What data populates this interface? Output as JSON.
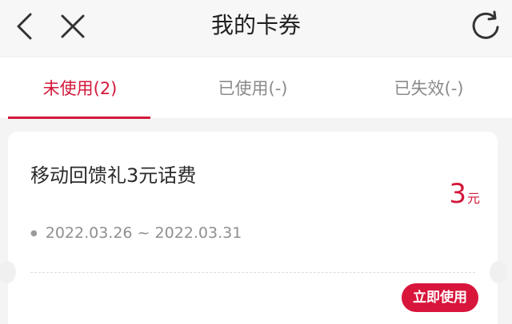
{
  "header": {
    "title": "我的卡券",
    "back_icon": "chevron-left-icon",
    "close_icon": "close-icon",
    "refresh_icon": "refresh-icon"
  },
  "tabs": [
    {
      "label": "未使用(2)",
      "active": true
    },
    {
      "label": "已使用(-)",
      "active": false
    },
    {
      "label": "已失效(-)",
      "active": false
    }
  ],
  "coupon": {
    "name": "移动回馈礼3元话费",
    "value": "3",
    "unit": "元",
    "validity": "2022.03.26 ~ 2022.03.31",
    "action_label": "立即使用"
  },
  "colors": {
    "accent": "#d3183a",
    "background": "#f4f4f4"
  }
}
